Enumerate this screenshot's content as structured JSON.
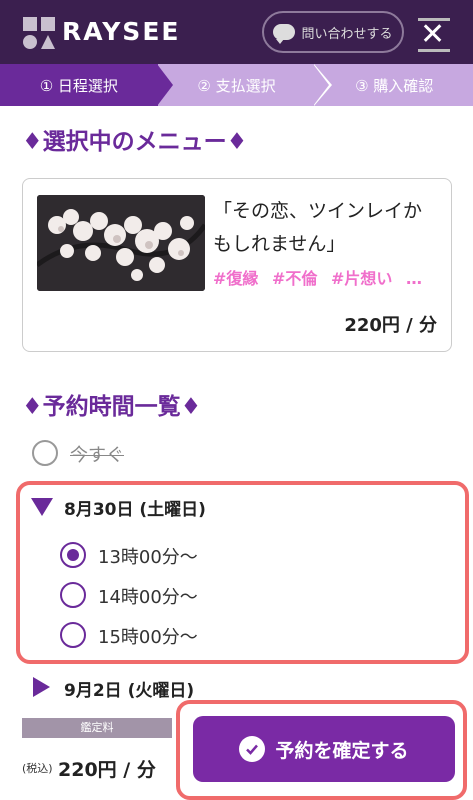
{
  "header": {
    "brand": "RAYSEE",
    "contact_label": "問い合わせする",
    "colors": {
      "header_bg": "#3b1f4f",
      "accent": "#6a2a9a",
      "tag_pink": "#f06fcb",
      "highlight": "#f06b6b"
    }
  },
  "steps": [
    {
      "label": "① 日程選択",
      "active": true
    },
    {
      "label": "② 支払選択",
      "active": false
    },
    {
      "label": "③ 購入確認",
      "active": false
    }
  ],
  "selected_menu": {
    "section_title": "♦選択中のメニュー♦",
    "title": "「その恋、ツインレイかもしれません」",
    "tags": [
      "#復縁",
      "#不倫",
      "#片想い",
      "…"
    ],
    "price": "220円 / 分"
  },
  "schedule": {
    "section_title": "♦予約時間一覧♦",
    "now_label": "今すぐ",
    "dates": [
      {
        "label": "8月30日 (土曜日)",
        "expanded": true,
        "times": [
          {
            "label": "13時00分〜",
            "checked": true
          },
          {
            "label": "14時00分〜",
            "checked": false
          },
          {
            "label": "15時00分〜",
            "checked": false
          }
        ]
      },
      {
        "label": "9月2日 (火曜日)",
        "expanded": false
      }
    ]
  },
  "footer": {
    "fee_label": "鑑定料",
    "tax_label": "(税込)",
    "price": "220円 / 分",
    "confirm_label": "予約を確定する"
  }
}
